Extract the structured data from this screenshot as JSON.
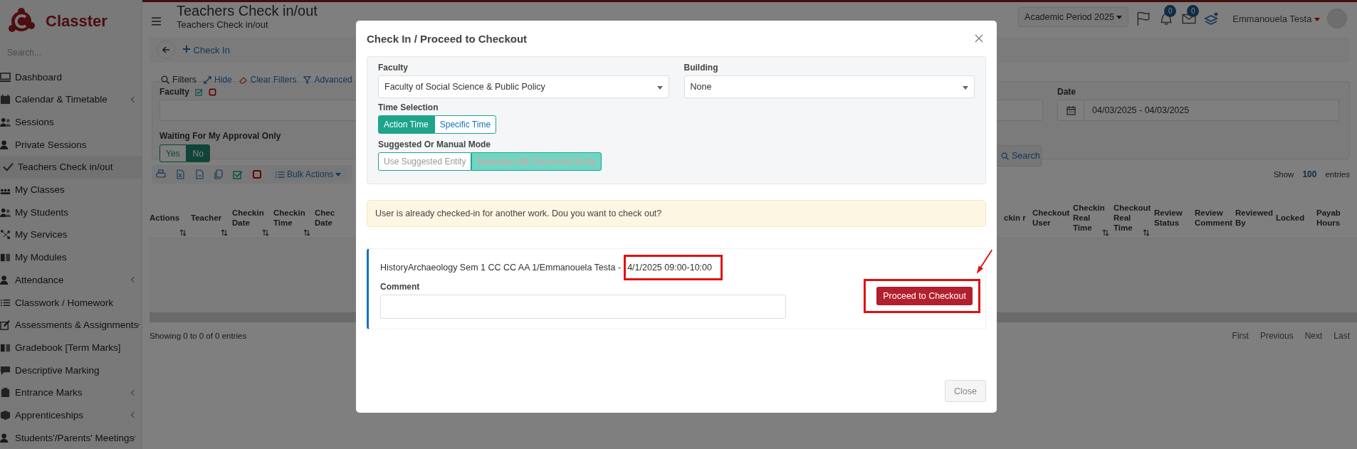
{
  "sidebar": {
    "brand": "Classter",
    "search": {
      "placeholder": "Search..."
    },
    "items": [
      {
        "label": "Dashboard",
        "selected": false,
        "has_submenu": false
      },
      {
        "label": "Calendar & Timetable",
        "selected": false,
        "has_submenu": true
      },
      {
        "label": "Sessions",
        "selected": false,
        "has_submenu": false
      },
      {
        "label": "Private Sessions",
        "selected": false,
        "has_submenu": false
      },
      {
        "label": "Teachers Check in/out",
        "selected": true,
        "has_submenu": false
      },
      {
        "label": "My Classes",
        "selected": false,
        "has_submenu": false
      },
      {
        "label": "My Students",
        "selected": false,
        "has_submenu": false
      },
      {
        "label": "My Services",
        "selected": false,
        "has_submenu": false
      },
      {
        "label": "My Modules",
        "selected": false,
        "has_submenu": false
      },
      {
        "label": "Attendance",
        "selected": false,
        "has_submenu": true
      },
      {
        "label": "Classwork / Homework",
        "selected": false,
        "has_submenu": false
      },
      {
        "label": "Assessments & Assignments",
        "selected": false,
        "has_submenu": true
      },
      {
        "label": "Gradebook [Term Marks]",
        "selected": false,
        "has_submenu": false
      },
      {
        "label": "Descriptive Marking",
        "selected": false,
        "has_submenu": false
      },
      {
        "label": "Entrance Marks",
        "selected": false,
        "has_submenu": true
      },
      {
        "label": "Apprenticeships",
        "selected": false,
        "has_submenu": true
      },
      {
        "label": "Students'/Parents' Meetings",
        "selected": false,
        "has_submenu": true
      }
    ]
  },
  "header": {
    "title": "Teachers Check in/out",
    "subtitle": "Teachers Check in/out",
    "period": "Academic Period 2025",
    "notifications": "0",
    "messages": "0",
    "user": "Emmanouela Testa"
  },
  "actions": {
    "check_in": "Check In"
  },
  "filters": {
    "toggle": "Filters",
    "hide": "Hide",
    "clear": "Clear Filters",
    "advanced": "Advanced",
    "faculty_label": "Faculty",
    "approval_label": "Waiting For My Approval Only",
    "approval_options": [
      {
        "label": "Yes",
        "selected": false
      },
      {
        "label": "No",
        "selected": true
      }
    ],
    "date_label": "Date",
    "date_value": "04/03/2025 - 04/03/2025",
    "search": "Search"
  },
  "toolbar": {
    "bulk_actions": "Bulk Actions",
    "show": "Show",
    "page_size": "100",
    "entries": "entries"
  },
  "table": {
    "left_columns": [
      {
        "label": "Actions",
        "sortable": true
      },
      {
        "label": "Teacher",
        "sortable": true
      },
      {
        "label": "Checkin Date",
        "sortable": true
      },
      {
        "label": "Checkin Time",
        "sortable": true
      },
      {
        "label": "Chec Date",
        "sortable": false
      }
    ],
    "right_columns": [
      {
        "label": "ckin r",
        "sortable": false
      },
      {
        "label": "Checkout User",
        "sortable": false
      },
      {
        "label": "Checkin Real Time",
        "sortable": true
      },
      {
        "label": "Checkout Real Time",
        "sortable": true
      },
      {
        "label": "Review Status",
        "sortable": false
      },
      {
        "label": "Review Comment",
        "sortable": false
      },
      {
        "label": "Reviewed By",
        "sortable": false
      },
      {
        "label": "Locked",
        "sortable": false
      },
      {
        "label": "Payab Hours",
        "sortable": false
      }
    ],
    "info": "Showing 0 to 0 of 0 entries",
    "pagination": [
      "First",
      "Previous",
      "Next",
      "Last"
    ]
  },
  "dialog": {
    "title": "Check In / Proceed to Checkout",
    "faculty": {
      "label": "Faculty",
      "value": "Faculty of Social Science & Public Policy"
    },
    "building": {
      "label": "Building",
      "value": "None"
    },
    "time_selection": {
      "label": "Time Selection",
      "options": [
        {
          "label": "Action Time",
          "selected": true
        },
        {
          "label": "Specific Time",
          "selected": false
        }
      ]
    },
    "mode": {
      "label": "Suggested Or Manual Mode",
      "options": [
        {
          "label": "Use Suggested Entity",
          "selected": false
        },
        {
          "label": "Manually Add Connected Entity",
          "selected": true
        }
      ]
    },
    "alert": "User is already checked-in for another work. Dou you want to check out?",
    "entry": {
      "course": "HistoryArchaeology Sem 1 CC CC AA 1/Emmanouela Testa -",
      "time": "4/1/2025 09:00-10:00",
      "time_marked": true,
      "comment_label": "Comment",
      "checkout_button": "Proceed to Checkout",
      "button_marked": true
    },
    "close": "Close"
  }
}
